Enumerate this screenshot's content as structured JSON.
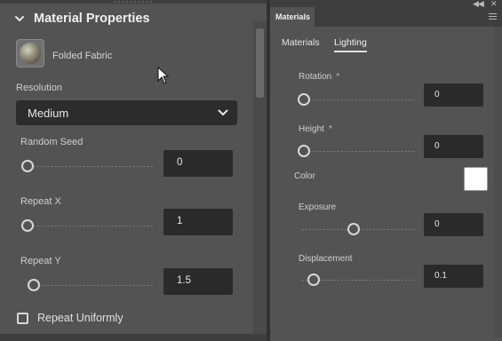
{
  "left_panel": {
    "section_title": "Material Properties",
    "material": {
      "name": "Folded Fabric",
      "thumbnail_icon": "fabric-sphere-icon"
    },
    "resolution": {
      "label": "Resolution",
      "value": "Medium"
    },
    "params": [
      {
        "label": "Random Seed",
        "value": "0",
        "slider_fraction": 0.0
      },
      {
        "label": "Repeat X",
        "value": "1",
        "slider_fraction": 0.0
      },
      {
        "label": "Repeat Y",
        "value": "1.5",
        "slider_fraction": 0.05
      }
    ],
    "repeat_uniformly": {
      "label": "Repeat Uniformly",
      "checked": false
    }
  },
  "right_panel": {
    "tab": "Materials",
    "subtabs": {
      "materials": "Materials",
      "lighting": "Lighting",
      "active": "Lighting"
    },
    "rotation": {
      "label": "Rotation",
      "required_mark": "*",
      "value": "0",
      "slider_fraction": 0.0
    },
    "height": {
      "label": "Height",
      "required_mark": "*",
      "value": "0",
      "slider_fraction": 0.0
    },
    "color": {
      "label": "Color",
      "swatch": "#ffffff"
    },
    "exposure": {
      "label": "Exposure",
      "value": "0",
      "slider_fraction": 0.5
    },
    "displacement": {
      "label": "Displacement",
      "value": "0.1",
      "slider_fraction": 0.1
    }
  },
  "colors": {
    "panel_bg": "#535353",
    "field_bg": "#2a2a2a",
    "text": "#d6d6d6",
    "bar_bg": "#3e3e3e"
  }
}
